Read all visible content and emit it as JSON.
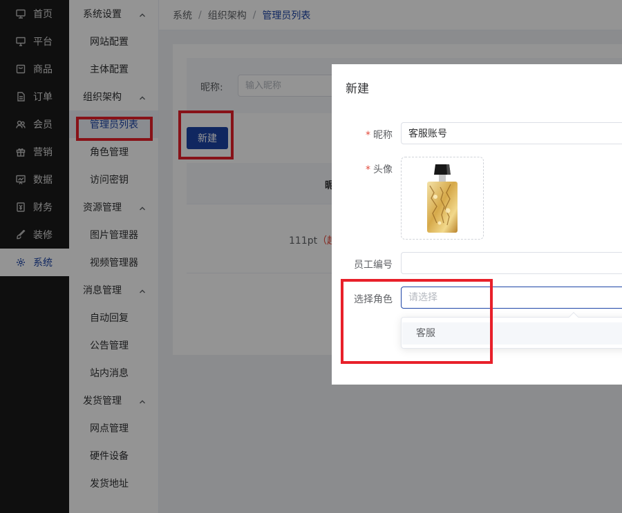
{
  "nav_primary": [
    {
      "label": "首页",
      "icon": "monitor-icon"
    },
    {
      "label": "平台",
      "icon": "desktop-icon"
    },
    {
      "label": "商品",
      "icon": "product-icon"
    },
    {
      "label": "订单",
      "icon": "document-icon"
    },
    {
      "label": "会员",
      "icon": "users-icon"
    },
    {
      "label": "营销",
      "icon": "gift-icon"
    },
    {
      "label": "数据",
      "icon": "chart-icon"
    },
    {
      "label": "财务",
      "icon": "finance-icon"
    },
    {
      "label": "装修",
      "icon": "brush-icon"
    },
    {
      "label": "系统",
      "icon": "gear-icon"
    }
  ],
  "nav_secondary": {
    "system_settings": "系统设置",
    "website_config": "网站配置",
    "entity_config": "主体配置",
    "org_structure": "组织架构",
    "admin_list": "管理员列表",
    "role_management": "角色管理",
    "access_keys": "访问密钥",
    "resource_management": "资源管理",
    "image_manager": "图片管理器",
    "video_manager": "视频管理器",
    "message_management": "消息管理",
    "auto_reply": "自动回复",
    "announcement_management": "公告管理",
    "site_messages": "站内消息",
    "shipping_management": "发货管理",
    "outlet_management": "网点管理",
    "hardware_devices": "硬件设备",
    "shipping_address": "发货地址"
  },
  "breadcrumb": {
    "level1": "系统",
    "level2": "组织架构",
    "current": "管理员列表",
    "separator": "/"
  },
  "filter": {
    "label": "昵称:",
    "placeholder": "输入昵称"
  },
  "new_button_label": "新建",
  "table": {
    "header_fragment": "昵",
    "row_text": "111pt",
    "row_warning": "（超"
  },
  "dialog": {
    "title": "新建",
    "fields": {
      "nickname_label": "昵称",
      "nickname_value": "客服账号",
      "avatar_label": "头像",
      "employee_id_label": "员工编号",
      "employee_id_value": "",
      "role_label": "选择角色",
      "role_placeholder": "请选择",
      "required_mark": "*"
    },
    "role_options": [
      "客服"
    ]
  },
  "colors": {
    "brand": "#1c44a6",
    "sidebar_bg": "#1b1b1b",
    "highlight": "#e8202a",
    "required": "#e3493b"
  }
}
